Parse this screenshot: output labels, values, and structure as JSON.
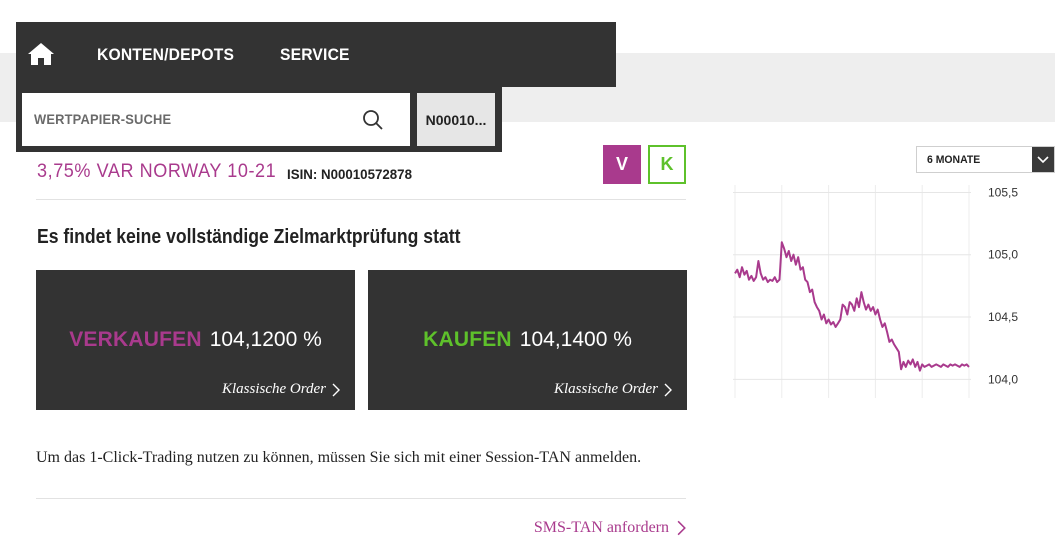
{
  "nav": {
    "konten_label": "KONTEN/DEPOTS",
    "service_label": "SERVICE"
  },
  "search": {
    "placeholder": "WERTPAPIER-SUCHE",
    "isin_chip": "N00010..."
  },
  "security": {
    "title": "3,75% VAR NORWAY 10-21",
    "isin_label": "ISIN: N00010572878",
    "sell_toggle": "V",
    "buy_toggle": "K"
  },
  "warning": "Es findet keine vollständige Zielmarktprüfung statt",
  "orders": {
    "sell": {
      "label": "VERKAUFEN",
      "price": "104,1200 %",
      "link": "Klassische Order"
    },
    "buy": {
      "label": "KAUFEN",
      "price": "104,1400 %",
      "link": "Klassische Order"
    }
  },
  "info_text": "Um das 1-Click-Trading nutzen zu können, müssen Sie sich mit einer Session-TAN anmelden.",
  "sms_link": "SMS-TAN anfordern",
  "colors": {
    "accent": "#a93a8d",
    "buy": "#5ec12b",
    "dark": "#333333"
  },
  "chart_range": "6 MONATE",
  "chart_data": {
    "type": "line",
    "title": "",
    "xlabel": "",
    "ylabel": "",
    "ylim": [
      103.85,
      105.6
    ],
    "y_ticks": [
      "105,5",
      "105,0",
      "104,5",
      "104,0"
    ],
    "y_tick_values": [
      105.5,
      105.0,
      104.5,
      104.0
    ],
    "grid": true,
    "series": [
      {
        "color": "#a93a8d",
        "x": [
          0,
          1,
          2,
          3,
          4,
          5,
          6,
          7,
          8,
          9,
          10,
          11,
          12,
          13,
          14,
          15,
          16,
          17,
          18,
          19,
          20,
          21,
          22,
          23,
          24,
          25,
          26,
          27,
          28,
          29,
          30,
          31,
          32,
          33,
          34,
          35,
          36,
          37,
          38,
          39,
          40,
          41,
          42,
          43,
          44,
          45,
          46,
          47,
          48,
          49,
          50,
          51,
          52,
          53,
          54,
          55,
          56,
          57,
          58,
          59,
          60,
          61,
          62,
          63,
          64,
          65,
          66,
          67,
          68,
          69,
          70,
          71,
          72,
          73,
          74,
          75,
          76,
          77,
          78,
          79,
          80,
          81,
          82,
          83,
          84,
          85,
          86,
          87,
          88,
          89,
          90,
          91,
          92,
          93,
          94,
          95,
          96,
          97,
          98,
          99,
          100
        ],
        "y": [
          104.85,
          104.88,
          104.82,
          104.9,
          104.84,
          104.87,
          104.8,
          104.83,
          104.79,
          104.82,
          104.95,
          104.85,
          104.8,
          104.82,
          104.78,
          104.8,
          104.79,
          104.82,
          104.78,
          104.8,
          105.1,
          105.05,
          104.98,
          105.03,
          104.95,
          105.0,
          104.92,
          104.98,
          104.88,
          104.9,
          104.8,
          104.78,
          104.7,
          104.72,
          104.62,
          104.58,
          104.55,
          104.48,
          104.52,
          104.45,
          104.48,
          104.44,
          104.46,
          104.42,
          104.45,
          104.48,
          104.6,
          104.58,
          104.52,
          104.62,
          104.6,
          104.55,
          104.65,
          104.58,
          104.7,
          104.62,
          104.56,
          104.6,
          104.55,
          104.58,
          104.52,
          104.56,
          104.48,
          104.42,
          104.45,
          104.38,
          104.3,
          104.32,
          104.28,
          104.25,
          104.22,
          104.08,
          104.14,
          104.1,
          104.15,
          104.12,
          104.16,
          104.1,
          104.14,
          104.07,
          104.12,
          104.1,
          104.11,
          104.12,
          104.1,
          104.11,
          104.12,
          104.11,
          104.1,
          104.12,
          104.11,
          104.1,
          104.12,
          104.11,
          104.12,
          104.11,
          104.1,
          104.12,
          104.11,
          104.12,
          104.1
        ]
      }
    ]
  }
}
